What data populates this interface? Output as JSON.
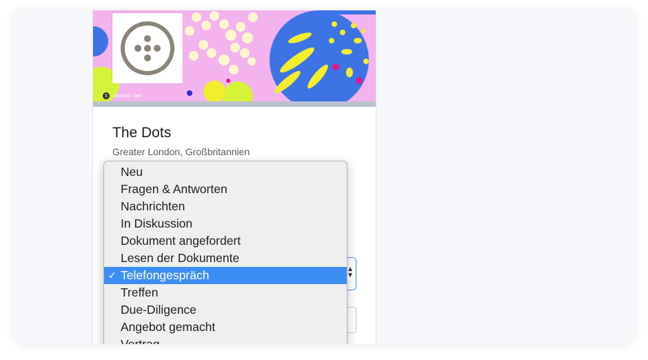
{
  "banner": {
    "credit_text": "Sponsor Text",
    "colors": {
      "background": "#f2a9e8",
      "globe": "#3c74e6",
      "accent": "#f4ec2a"
    }
  },
  "logo": {
    "icon": "dots-circle-logo-icon"
  },
  "company": {
    "name": "The Dots",
    "location": "Greater London, Großbritannien"
  },
  "status_dropdown": {
    "selected": "Telefongespräch",
    "checkmark": "✓",
    "options": [
      "Neu",
      "Fragen & Antworten",
      "Nachrichten",
      "In Diskussion",
      "Dokument angefordert",
      "Lesen der Dokumente",
      "Telefongespräch",
      "Treffen",
      "Due-Diligence",
      "Angebot gemacht",
      "Vertrag"
    ]
  },
  "select_control": {
    "arrows": "▲▼"
  },
  "colors": {
    "selection": "#3b8ff4",
    "focus_border": "#3e8ee8"
  }
}
